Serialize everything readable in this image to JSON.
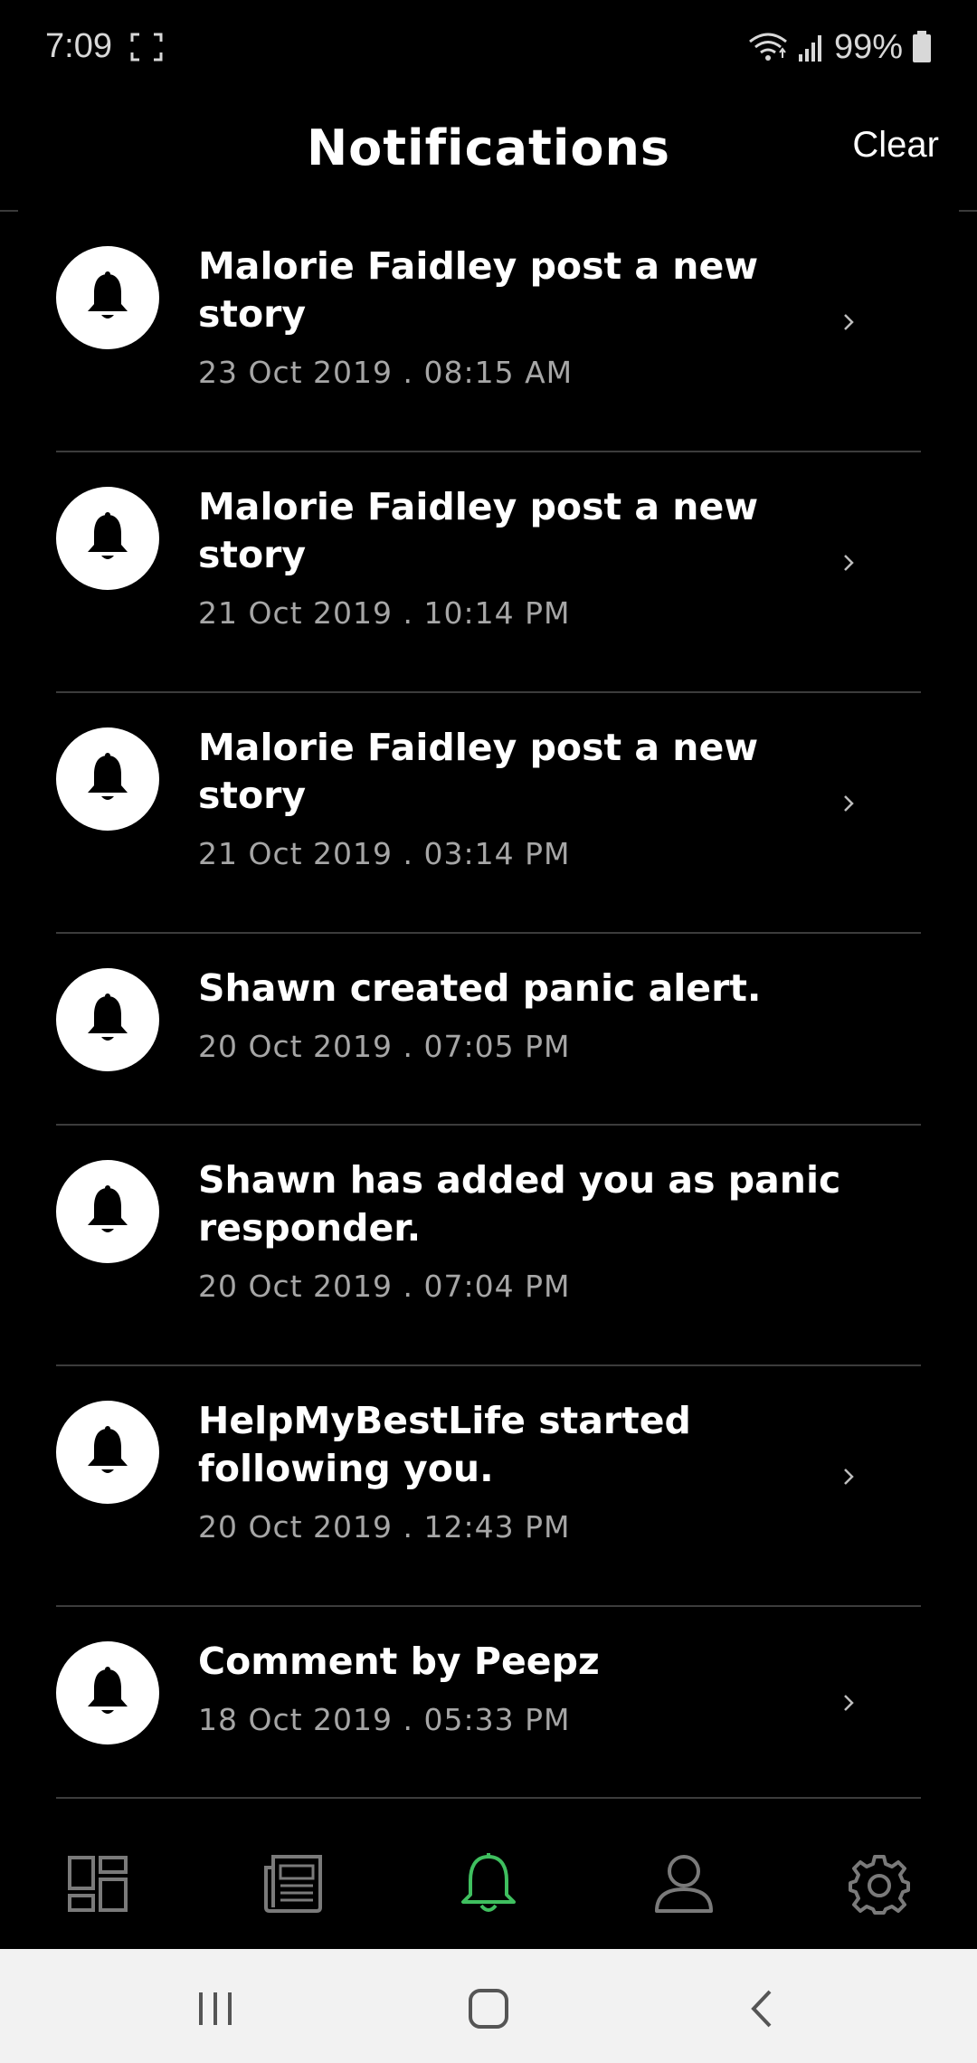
{
  "status_bar": {
    "time": "7:09",
    "battery": "99%"
  },
  "header": {
    "title": "Notifications",
    "clear_label": "Clear"
  },
  "notifications": [
    {
      "title": "Malorie Faidley post a new story",
      "time": "23 Oct 2019 . 08:15 AM",
      "has_chevron": true
    },
    {
      "title": "Malorie Faidley post a new story",
      "time": "21 Oct 2019 . 10:14 PM",
      "has_chevron": true
    },
    {
      "title": "Malorie Faidley post a new story",
      "time": "21 Oct 2019 . 03:14 PM",
      "has_chevron": true
    },
    {
      "title": "Shawn created panic alert.",
      "time": "20 Oct 2019 . 07:05 PM",
      "has_chevron": false
    },
    {
      "title": "Shawn has added you as panic responder.",
      "time": "20 Oct 2019 . 07:04 PM",
      "has_chevron": false
    },
    {
      "title": "HelpMyBestLife started following you.",
      "time": "20 Oct 2019 . 12:43 PM",
      "has_chevron": true
    },
    {
      "title": "Comment by Peepz",
      "time": "18 Oct 2019 . 05:33 PM",
      "has_chevron": true
    }
  ],
  "bottom_nav": {
    "items": [
      {
        "icon": "dashboard-icon",
        "active": false
      },
      {
        "icon": "news-icon",
        "active": false
      },
      {
        "icon": "bell-icon",
        "active": true
      },
      {
        "icon": "profile-icon",
        "active": false
      },
      {
        "icon": "gear-icon",
        "active": false
      }
    ],
    "active_color": "#3fbf5f",
    "inactive_color": "#7a7a7a"
  },
  "system_nav": {
    "items": [
      "recents-icon",
      "home-icon",
      "back-icon"
    ]
  }
}
